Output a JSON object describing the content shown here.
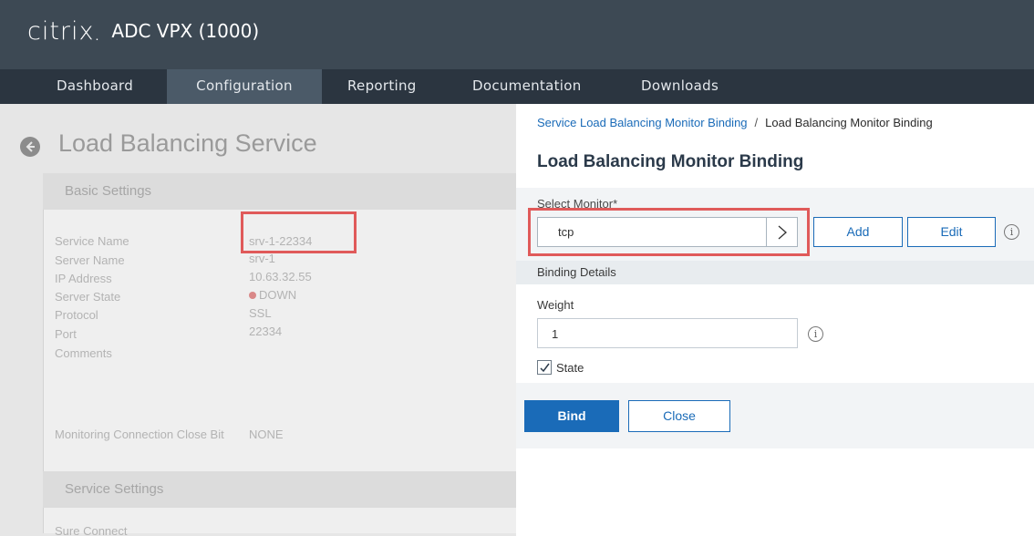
{
  "header": {
    "logo": "citrix",
    "product": "ADC VPX (1000)"
  },
  "nav": {
    "items": [
      {
        "label": "Dashboard"
      },
      {
        "label": "Configuration"
      },
      {
        "label": "Reporting"
      },
      {
        "label": "Documentation"
      },
      {
        "label": "Downloads"
      }
    ],
    "active": "Configuration"
  },
  "background": {
    "title": "Load Balancing Service",
    "basic_settings": "Basic Settings",
    "service_settings": "Service Settings",
    "fields": [
      {
        "label": "Service Name",
        "value": "srv-1-22334"
      },
      {
        "label": "Server Name",
        "value": "srv-1"
      },
      {
        "label": "IP Address",
        "value": "10.63.32.55"
      },
      {
        "label": "Server State",
        "value": "DOWN"
      },
      {
        "label": "Protocol",
        "value": "SSL"
      },
      {
        "label": "Port",
        "value": "22334"
      },
      {
        "label": "Comments",
        "value": ""
      }
    ],
    "monitoring": {
      "label": "Monitoring Connection Close Bit",
      "value": "NONE"
    },
    "sure_connect": "Sure Connect"
  },
  "panel": {
    "breadcrumb_link": "Service Load Balancing Monitor Binding",
    "breadcrumb_sep": "/",
    "breadcrumb_current": "Load Balancing Monitor Binding",
    "title": "Load Balancing Monitor Binding",
    "select_monitor_label": "Select Monitor*",
    "select_monitor_value": "tcp",
    "add_label": "Add",
    "edit_label": "Edit",
    "binding_details": "Binding Details",
    "weight_label": "Weight",
    "weight_value": "1",
    "state_label": "State",
    "state_checked": true,
    "bind_label": "Bind",
    "close_label": "Close",
    "info_glyph": "i"
  },
  "colors": {
    "header_bg": "#3d4954",
    "nav_bg": "#2b3540",
    "accent": "#1a6bb8",
    "highlight": "#e05a5a"
  }
}
